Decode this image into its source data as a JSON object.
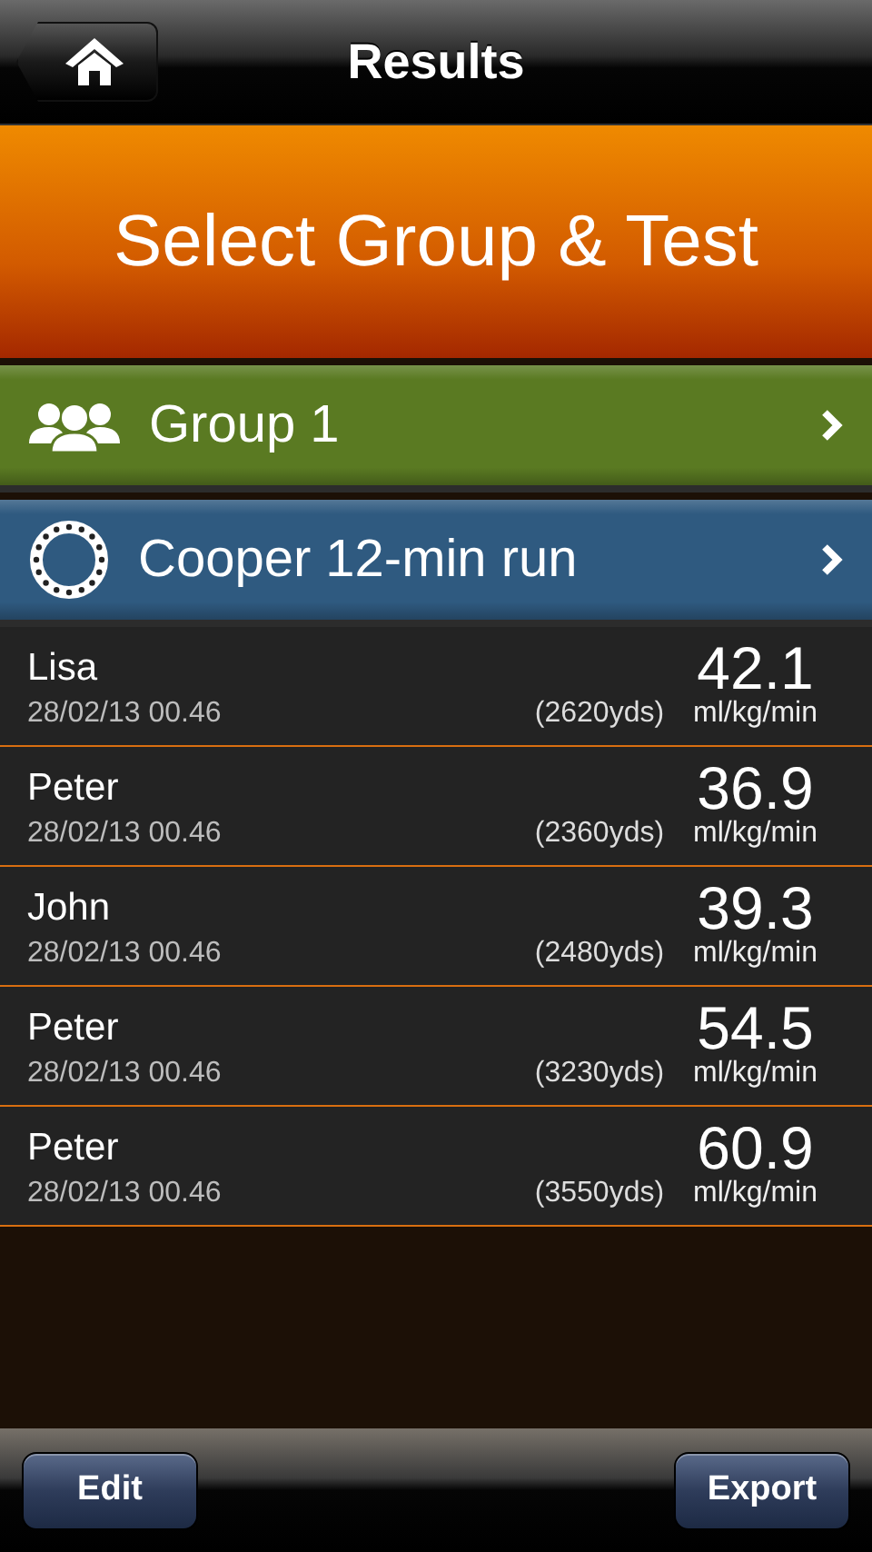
{
  "nav_bar": {
    "title": "Results"
  },
  "banner": {
    "title": "Select Group & Test"
  },
  "selectors": [
    {
      "kind": "group",
      "label": "Group 1",
      "color": "#5a7a22"
    },
    {
      "kind": "test",
      "label": "Cooper 12-min run",
      "color": "#2f5a80"
    }
  ],
  "results": [
    {
      "name": "Lisa",
      "date": "28/02/13 00.46",
      "distance": "(2620yds)",
      "value": "42.1",
      "unit": "ml/kg/min"
    },
    {
      "name": "Peter",
      "date": "28/02/13 00.46",
      "distance": "(2360yds)",
      "value": "36.9",
      "unit": "ml/kg/min"
    },
    {
      "name": "John",
      "date": "28/02/13 00.46",
      "distance": "(2480yds)",
      "value": "39.3",
      "unit": "ml/kg/min"
    },
    {
      "name": "Peter",
      "date": "28/02/13 00.46",
      "distance": "(3230yds)",
      "value": "54.5",
      "unit": "ml/kg/min"
    },
    {
      "name": "Peter",
      "date": "28/02/13 00.46",
      "distance": "(3550yds)",
      "value": "60.9",
      "unit": "ml/kg/min"
    }
  ],
  "toolbar": {
    "buttons": [
      "Edit",
      "Export"
    ]
  }
}
